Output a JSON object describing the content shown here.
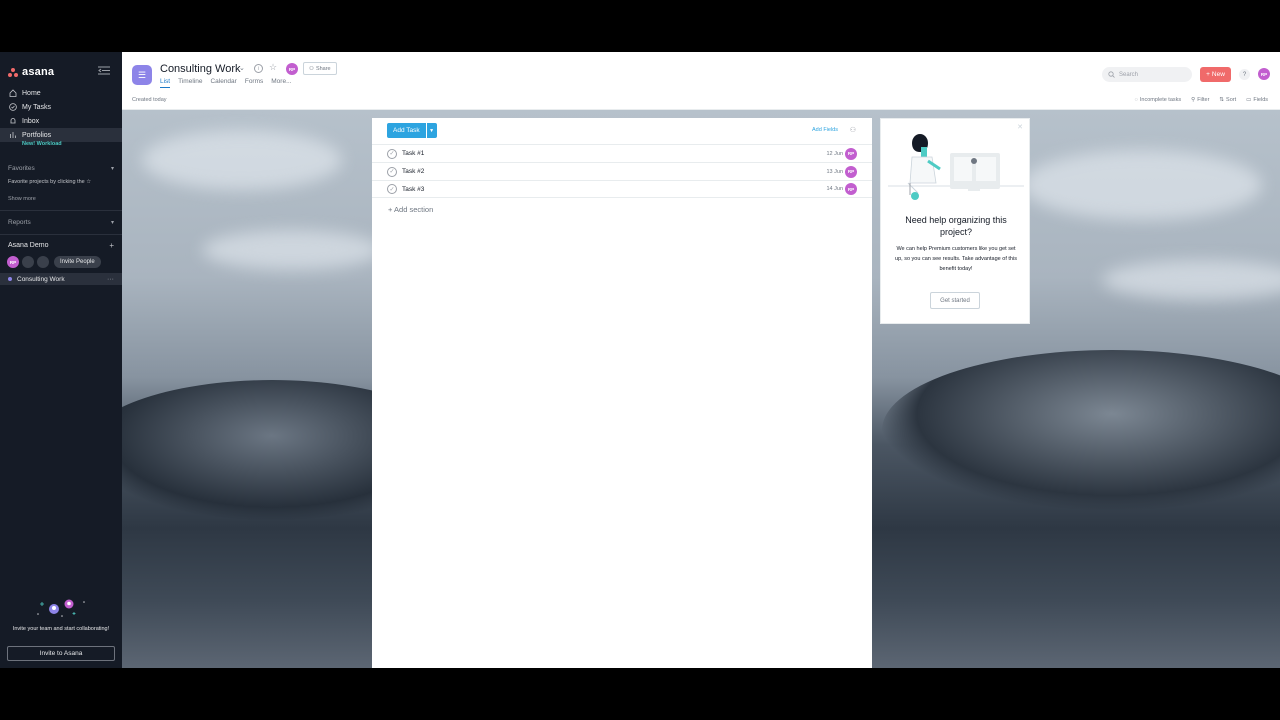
{
  "sidebar": {
    "logo_text": "asana",
    "nav": [
      {
        "label": "Home",
        "icon": "home-icon"
      },
      {
        "label": "My Tasks",
        "icon": "check-circle-icon"
      },
      {
        "label": "Inbox",
        "icon": "bell-icon"
      },
      {
        "label": "Portfolios",
        "icon": "bar-chart-icon"
      }
    ],
    "portfolios_badge": "New! Workload",
    "favorites_title": "Favorites",
    "favorites_text": "Favorite projects by clicking the ☆",
    "show_more": "Show more",
    "reports_title": "Reports",
    "team_name": "Asana Demo",
    "team_avatar": "RP",
    "invite_people": "Invite People",
    "project": "Consulting Work",
    "invite_text": "Invite your team and start collaborating!",
    "invite_button": "Invite to Asana"
  },
  "header": {
    "project_title": "Consulting Work",
    "avatar": "RP",
    "share": "Share",
    "tabs": [
      "List",
      "Timeline",
      "Calendar",
      "Forms",
      "More..."
    ],
    "search_placeholder": "Search",
    "new_button": "New",
    "help": "?",
    "user_avatar": "RP"
  },
  "subheader": {
    "created": "Created today",
    "incomplete": "Incomplete tasks",
    "filter": "Filter",
    "sort": "Sort",
    "fields": "Fields"
  },
  "tasks_panel": {
    "add_task": "Add Task",
    "add_fields": "Add Fields",
    "tasks": [
      {
        "name": "Task #1",
        "date": "12 Jun",
        "assignee": "RP"
      },
      {
        "name": "Task #2",
        "date": "13 Jun",
        "assignee": "RP"
      },
      {
        "name": "Task #3",
        "date": "14 Jun",
        "assignee": "RP"
      }
    ],
    "add_section": "+ Add section"
  },
  "help_card": {
    "title": "Need help organizing this project?",
    "body": "We can help Premium customers like you get set up, so you can see results. Take advantage of this benefit today!",
    "button": "Get started"
  },
  "colors": {
    "sidebar_bg": "#151b26",
    "accent_blue": "#2da4e0",
    "new_button": "#f06a6a",
    "project_purple": "#8d84e8",
    "avatar_pink": "#c25ecf"
  }
}
